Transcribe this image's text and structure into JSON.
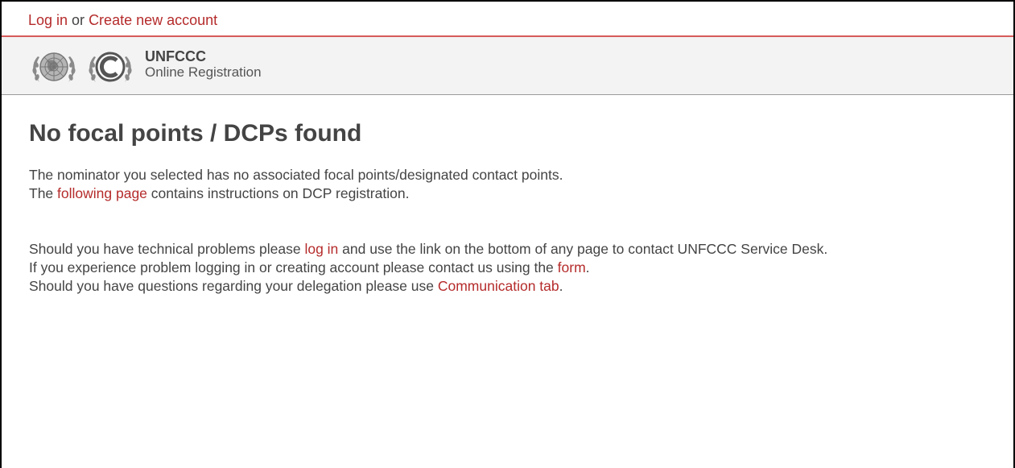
{
  "topbar": {
    "login_label": "Log in",
    "or_text": " or ",
    "create_account_label": "Create new account"
  },
  "brand": {
    "title": "UNFCCC",
    "subtitle": "Online Registration",
    "un_logo_icon": "un-emblem-icon",
    "unfccc_logo_icon": "unfccc-logo-icon"
  },
  "main": {
    "heading": "No focal points / DCPs found",
    "line1": "The nominator you selected has no associated focal points/designated contact points.",
    "line2_pre": "The ",
    "line2_link": "following page",
    "line2_post": " contains instructions on DCP registration.",
    "help1_pre": "Should you have technical problems please ",
    "help1_link": "log in",
    "help1_post": " and use the link on the bottom of any page to contact UNFCCC Service Desk.",
    "help2_pre": "If you experience problem logging in or creating account please contact us using the ",
    "help2_link": "form",
    "help2_post": ".",
    "help3_pre": "Should you have questions regarding your delegation please use ",
    "help3_link": "Communication tab",
    "help3_post": "."
  },
  "colors": {
    "link": "#b52b2b",
    "text": "#444444",
    "header_bg": "#f3f3f3",
    "accent_line": "#d65a5a"
  }
}
